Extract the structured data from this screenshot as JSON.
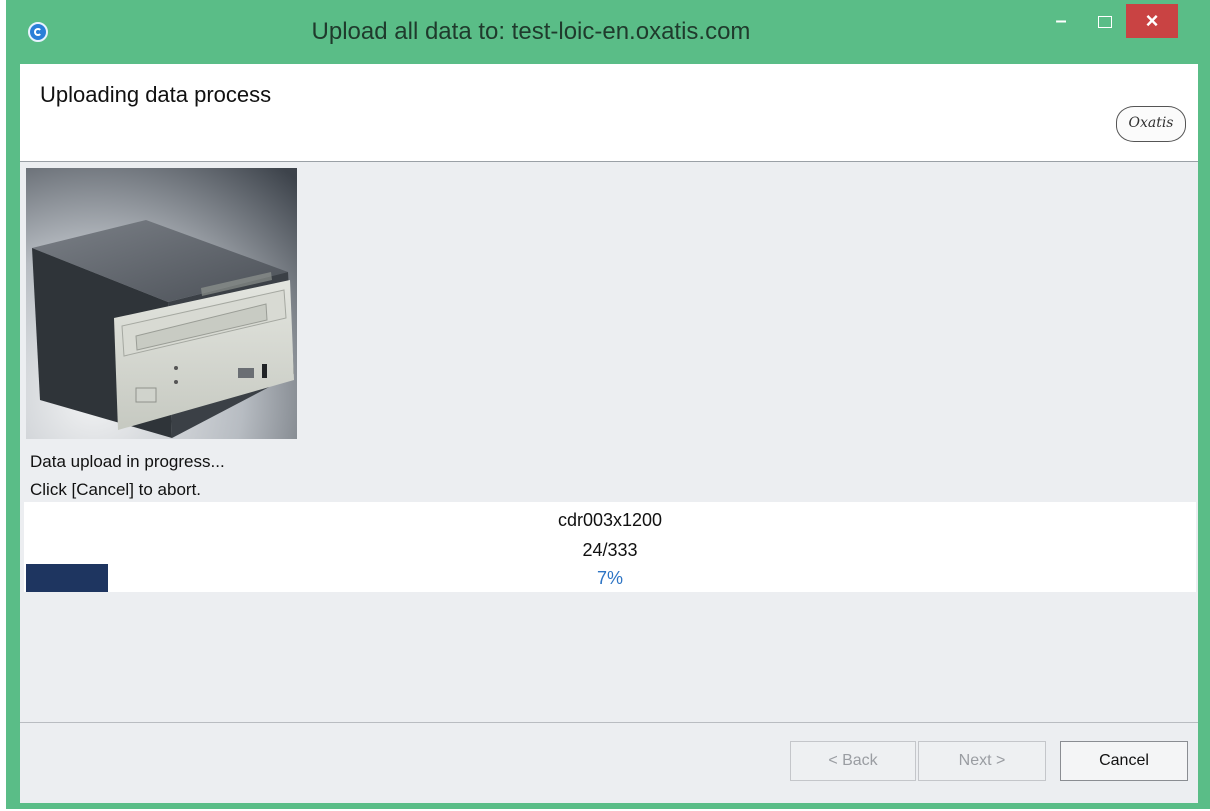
{
  "window": {
    "title": "Upload all data to: test-loic-en.oxatis.com",
    "controls": {
      "minimize": "–",
      "close": "×"
    }
  },
  "header": {
    "title": "Uploading data process",
    "logo_text": "Oxatis"
  },
  "content": {
    "image_subject": "cd-drive-image",
    "message_line1": "Data upload in progress...",
    "message_line2": "Click [Cancel] to abort."
  },
  "progress": {
    "current_item": "cdr003x1200",
    "counter": "24/333",
    "percent_text": "7%",
    "fraction": 0.07,
    "bar_color": "#1e3560"
  },
  "footer": {
    "back_label": "< Back",
    "next_label": "Next >",
    "cancel_label": "Cancel"
  },
  "colors": {
    "frame": "#5abd87",
    "close_button": "#c94343",
    "percent_text": "#2d74c4"
  }
}
